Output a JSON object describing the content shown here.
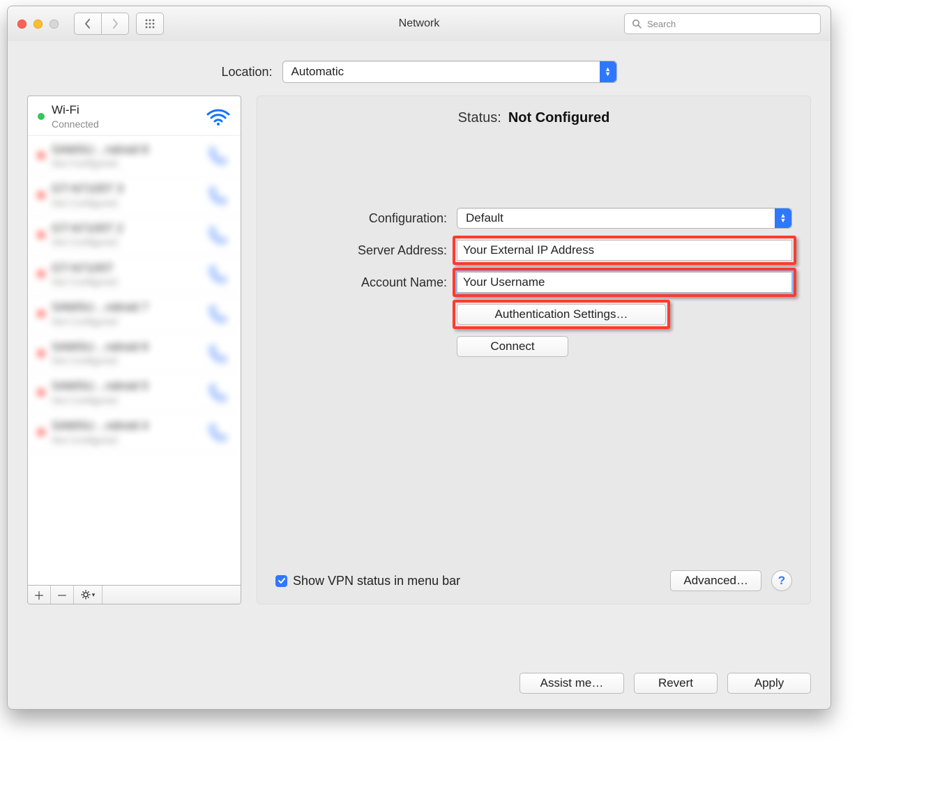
{
  "window": {
    "title": "Network",
    "search_placeholder": "Search"
  },
  "location": {
    "label": "Location:",
    "value": "Automatic"
  },
  "sidebar": {
    "items": [
      {
        "name": "Wi-Fi",
        "sub": "Connected",
        "status": "green",
        "icon": "wifi"
      },
      {
        "name": "SAMSU…ndroid 8",
        "sub": "Not Configured",
        "status": "red",
        "icon": "phone"
      },
      {
        "name": "GT-N7105T 3",
        "sub": "Not Configured",
        "status": "red",
        "icon": "phone"
      },
      {
        "name": "GT-N7105T 2",
        "sub": "Not Configured",
        "status": "red",
        "icon": "phone"
      },
      {
        "name": "GT-N7105T",
        "sub": "Not Configured",
        "status": "red",
        "icon": "phone"
      },
      {
        "name": "SAMSU…ndroid 7",
        "sub": "Not Configured",
        "status": "red",
        "icon": "phone"
      },
      {
        "name": "SAMSU…ndroid 6",
        "sub": "Not Configured",
        "status": "red",
        "icon": "phone"
      },
      {
        "name": "SAMSU…ndroid 5",
        "sub": "Not Configured",
        "status": "red",
        "icon": "phone"
      },
      {
        "name": "SAMSU…ndroid 4",
        "sub": "Not Configured",
        "status": "red",
        "icon": "phone"
      }
    ]
  },
  "panel": {
    "status_label": "Status:",
    "status_value": "Not Configured",
    "config_label": "Configuration:",
    "config_value": "Default",
    "server_label": "Server Address:",
    "server_value": "Your External IP Address",
    "account_label": "Account Name:",
    "account_value": "Your Username",
    "auth_button": "Authentication Settings…",
    "connect_button": "Connect",
    "show_vpn_label": "Show VPN status in menu bar",
    "advanced_button": "Advanced…"
  },
  "footer": {
    "assist": "Assist me…",
    "revert": "Revert",
    "apply": "Apply"
  },
  "colors": {
    "highlight": "#ff3b2f",
    "accent": "#2e78ff"
  }
}
